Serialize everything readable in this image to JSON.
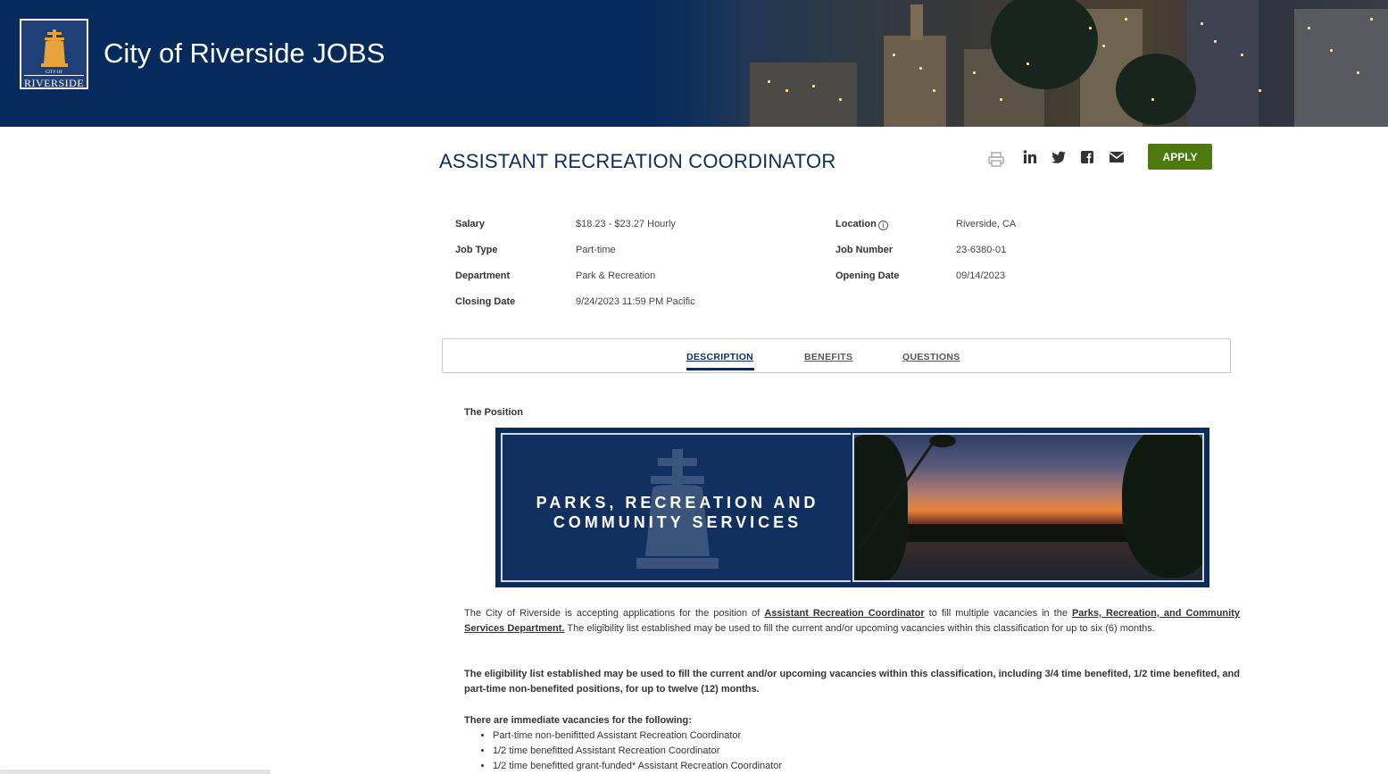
{
  "header": {
    "site_title": "City of Riverside JOBS",
    "logo_small": "CITY OF",
    "logo_name": "RIVERSIDE"
  },
  "job": {
    "title": "ASSISTANT RECREATION COORDINATOR",
    "apply_label": "APPLY",
    "share_icons": [
      "print-icon",
      "linkedin-icon",
      "twitter-icon",
      "facebook-icon",
      "email-icon"
    ]
  },
  "info": {
    "salary_label": "Salary",
    "salary": "$18.23 - $23.27 Hourly",
    "job_type_label": "Job Type",
    "job_type": "Part-time",
    "department_label": "Department",
    "department": "Park & Recreation",
    "closing_label": "Closing Date",
    "closing": "9/24/2023 11:59 PM Pacific",
    "location_label": "Location",
    "location": "Riverside, CA",
    "job_number_label": "Job Number",
    "job_number": "23-6380-01",
    "opening_label": "Opening Date",
    "opening": "09/14/2023"
  },
  "tabs": {
    "description": "DESCRIPTION",
    "benefits": "BENEFITS",
    "questions": "QUESTIONS"
  },
  "content": {
    "section_title": "The Position",
    "banner_line1": "PARKS, RECREATION AND",
    "banner_line2": "COMMUNITY SERVICES",
    "p1_a": "The City of Riverside is accepting applications for the position of ",
    "p1_link1": "Assistant Recreation Coordinator",
    "p1_b": " to fill multiple vacancies in the ",
    "p1_link2": "Parks, Recreation, and Community Services Department.",
    "p1_c": "  The eligibility list established may be used to fill the current and/or upcoming vacancies within this classification for up to six (6) months.",
    "p2": "The eligibility list established may be used to fill the current and/or upcoming vacancies within this classification, including 3/4 time benefited, 1/2 time benefited, and part-time non-benefited positions, for up to twelve (12) months.",
    "p3": "There are immediate vacancies for the following:",
    "list": [
      "Part-time non-benifitted Assistant Recreation Coordinator",
      "1/2 time benefitted Assistant Recreation Coordinator",
      "1/2 time benefitted grant-funded* Assistant Recreation Coordinator"
    ]
  },
  "colors": {
    "navy": "#062a5c",
    "title": "#0c2d5a",
    "apply": "#4d7a0f"
  }
}
